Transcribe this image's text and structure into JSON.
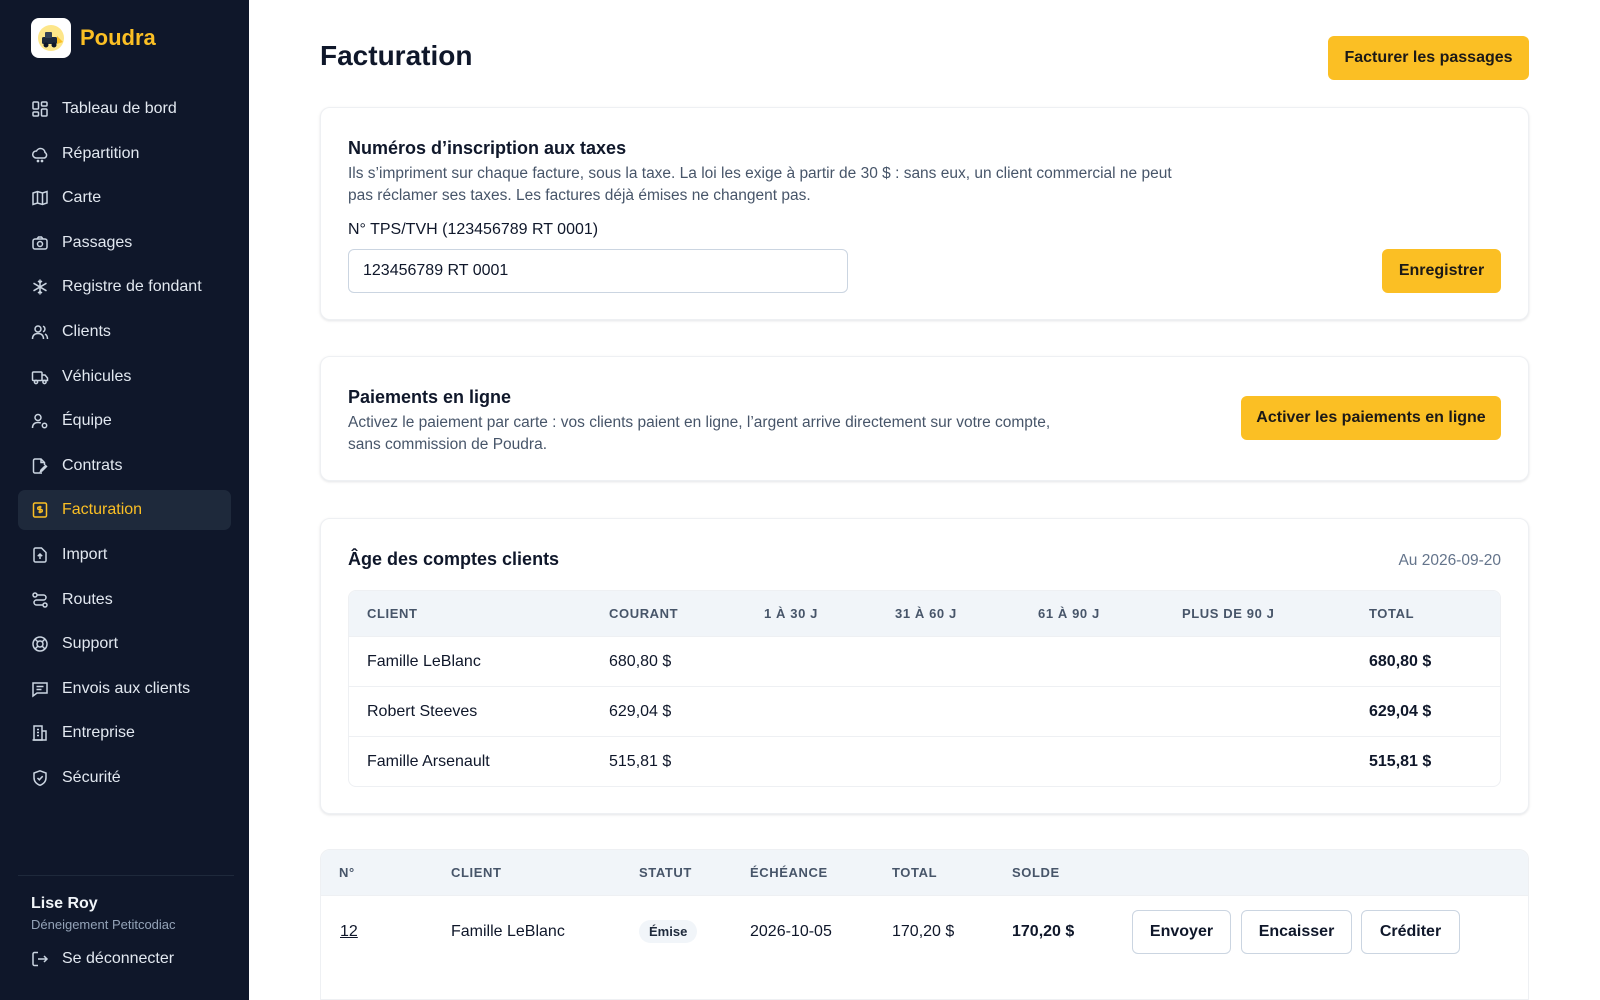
{
  "brand": {
    "name": "Poudra",
    "logo_icon": "snowplow-icon"
  },
  "sidebar": {
    "items": [
      {
        "label": "Tableau de bord",
        "icon": "dashboard-icon",
        "active": false
      },
      {
        "label": "Répartition",
        "icon": "cloud-icon",
        "active": false
      },
      {
        "label": "Carte",
        "icon": "map-icon",
        "active": false
      },
      {
        "label": "Passages",
        "icon": "camera-icon",
        "active": false
      },
      {
        "label": "Registre de fondant",
        "icon": "snowflake-icon",
        "active": false
      },
      {
        "label": "Clients",
        "icon": "users-icon",
        "active": false
      },
      {
        "label": "Véhicules",
        "icon": "truck-icon",
        "active": false
      },
      {
        "label": "Équipe",
        "icon": "user-gear-icon",
        "active": false
      },
      {
        "label": "Contrats",
        "icon": "contract-icon",
        "active": false
      },
      {
        "label": "Facturation",
        "icon": "invoice-icon",
        "active": true
      },
      {
        "label": "Import",
        "icon": "file-import-icon",
        "active": false
      },
      {
        "label": "Routes",
        "icon": "route-icon",
        "active": false
      },
      {
        "label": "Support",
        "icon": "lifebuoy-icon",
        "active": false
      },
      {
        "label": "Envois aux clients",
        "icon": "message-icon",
        "active": false
      },
      {
        "label": "Entreprise",
        "icon": "building-icon",
        "active": false
      },
      {
        "label": "Sécurité",
        "icon": "shield-icon",
        "active": false
      }
    ],
    "user": {
      "name": "Lise Roy",
      "org": "Déneigement Petitcodiac"
    },
    "logout_label": "Se déconnecter"
  },
  "header": {
    "title": "Facturation",
    "bill_button": "Facturer les passages"
  },
  "tax": {
    "title": "Numéros d’inscription aux taxes",
    "description": "Ils s’impriment sur chaque facture, sous la taxe. La loi les exige à partir de 30 $ : sans eux, un client commercial ne peut pas réclamer ses taxes. Les factures déjà émises ne changent pas.",
    "field_label": "N° TPS/TVH (123456789 RT 0001)",
    "field_value": "123456789 RT 0001",
    "save_button": "Enregistrer"
  },
  "payments": {
    "title": "Paiements en ligne",
    "description": "Activez le paiement par carte : vos clients paient en ligne, l’argent arrive directement sur votre compte, sans commission de Poudra.",
    "activate_button": "Activer les paiements en ligne"
  },
  "aging": {
    "title": "Âge des comptes clients",
    "as_of": "Au 2026-09-20",
    "columns": [
      "CLIENT",
      "COURANT",
      "1 À 30 J",
      "31 À 60 J",
      "61 À 90 J",
      "PLUS DE 90 J",
      "TOTAL"
    ],
    "rows": [
      {
        "client": "Famille LeBlanc",
        "current": "680,80 $",
        "d1_30": "",
        "d31_60": "",
        "d61_90": "",
        "d90_plus": "",
        "total": "680,80 $"
      },
      {
        "client": "Robert Steeves",
        "current": "629,04 $",
        "d1_30": "",
        "d31_60": "",
        "d61_90": "",
        "d90_plus": "",
        "total": "629,04 $"
      },
      {
        "client": "Famille Arsenault",
        "current": "515,81 $",
        "d1_30": "",
        "d31_60": "",
        "d61_90": "",
        "d90_plus": "",
        "total": "515,81 $"
      }
    ]
  },
  "invoices": {
    "columns": [
      "N°",
      "CLIENT",
      "STATUT",
      "ÉCHÉANCE",
      "TOTAL",
      "SOLDE"
    ],
    "rows": [
      {
        "number": "12",
        "client": "Famille LeBlanc",
        "status": "Émise",
        "due": "2026-10-05",
        "total": "170,20 $",
        "balance": "170,20 $"
      }
    ],
    "actions": {
      "send": "Envoyer",
      "collect": "Encaisser",
      "credit": "Créditer"
    }
  },
  "colors": {
    "sidebar_bg": "#0f172a",
    "accent": "#fbbf24",
    "active_item_bg": "#1e293b"
  }
}
